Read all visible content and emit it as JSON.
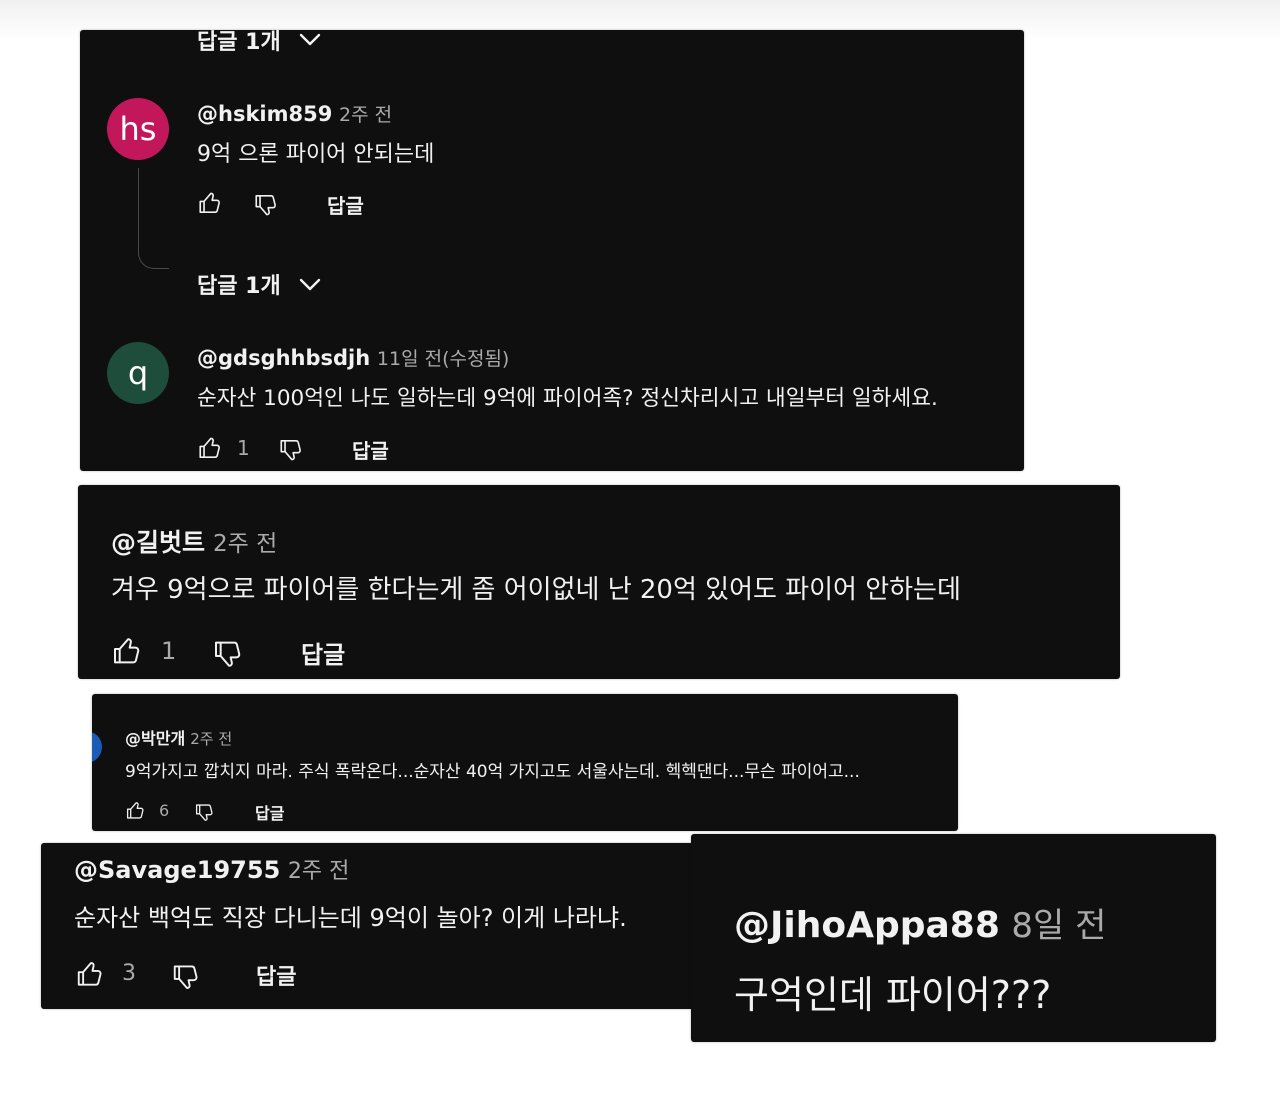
{
  "cards": {
    "top": {
      "first_replies_toggle": "답글 1개",
      "comment1": {
        "avatar_text": "hs",
        "avatar_color": "#c2185b",
        "username": "@hskim859",
        "time": "2주 전",
        "text": "9억 으론 파이어 안되는데",
        "reply_label": "답글",
        "replies_toggle": "답글 1개"
      },
      "comment2": {
        "avatar_text": "q",
        "avatar_color": "#1e4d3c",
        "username": "@gdsghhbsdjh",
        "time": "11일 전(수정됨)",
        "text": "순자산 100억인 나도 일하는데 9억에 파이어족?  정신차리시고 내일부터 일하세요.",
        "likes": "1",
        "reply_label": "답글"
      }
    },
    "gilbert": {
      "username": "@길벗트",
      "time": "2주 전",
      "text": "겨우 9억으로 파이어를 한다는게 좀 어이없네  난 20억 있어도 파이어 안하는데",
      "likes": "1",
      "reply_label": "답글"
    },
    "park": {
      "username": "@박만개",
      "time": "2주 전",
      "text": "9억가지고 깝치지 마라. 주식 폭락온다...순자산 40억 가지고도 서울사는데. 헥헥댄다...무슨 파이어고...",
      "likes": "6",
      "reply_label": "답글"
    },
    "savage": {
      "username": "@Savage19755",
      "time": "2주 전",
      "text": "순자산 백억도 직장 다니는데  9억이 놀아? 이게 나라냐.",
      "likes": "3",
      "reply_label": "답글"
    },
    "jiho": {
      "username": "@JihoAppa88",
      "time": "8일 전",
      "text": "구억인데 파이어???"
    }
  },
  "icons": [
    "thumbs-up-icon",
    "thumbs-down-icon",
    "chevron-down-icon"
  ],
  "colors": {
    "card_bg": "#0f0f0f",
    "text": "#f1f1f1",
    "muted": "#aaaaaa"
  }
}
